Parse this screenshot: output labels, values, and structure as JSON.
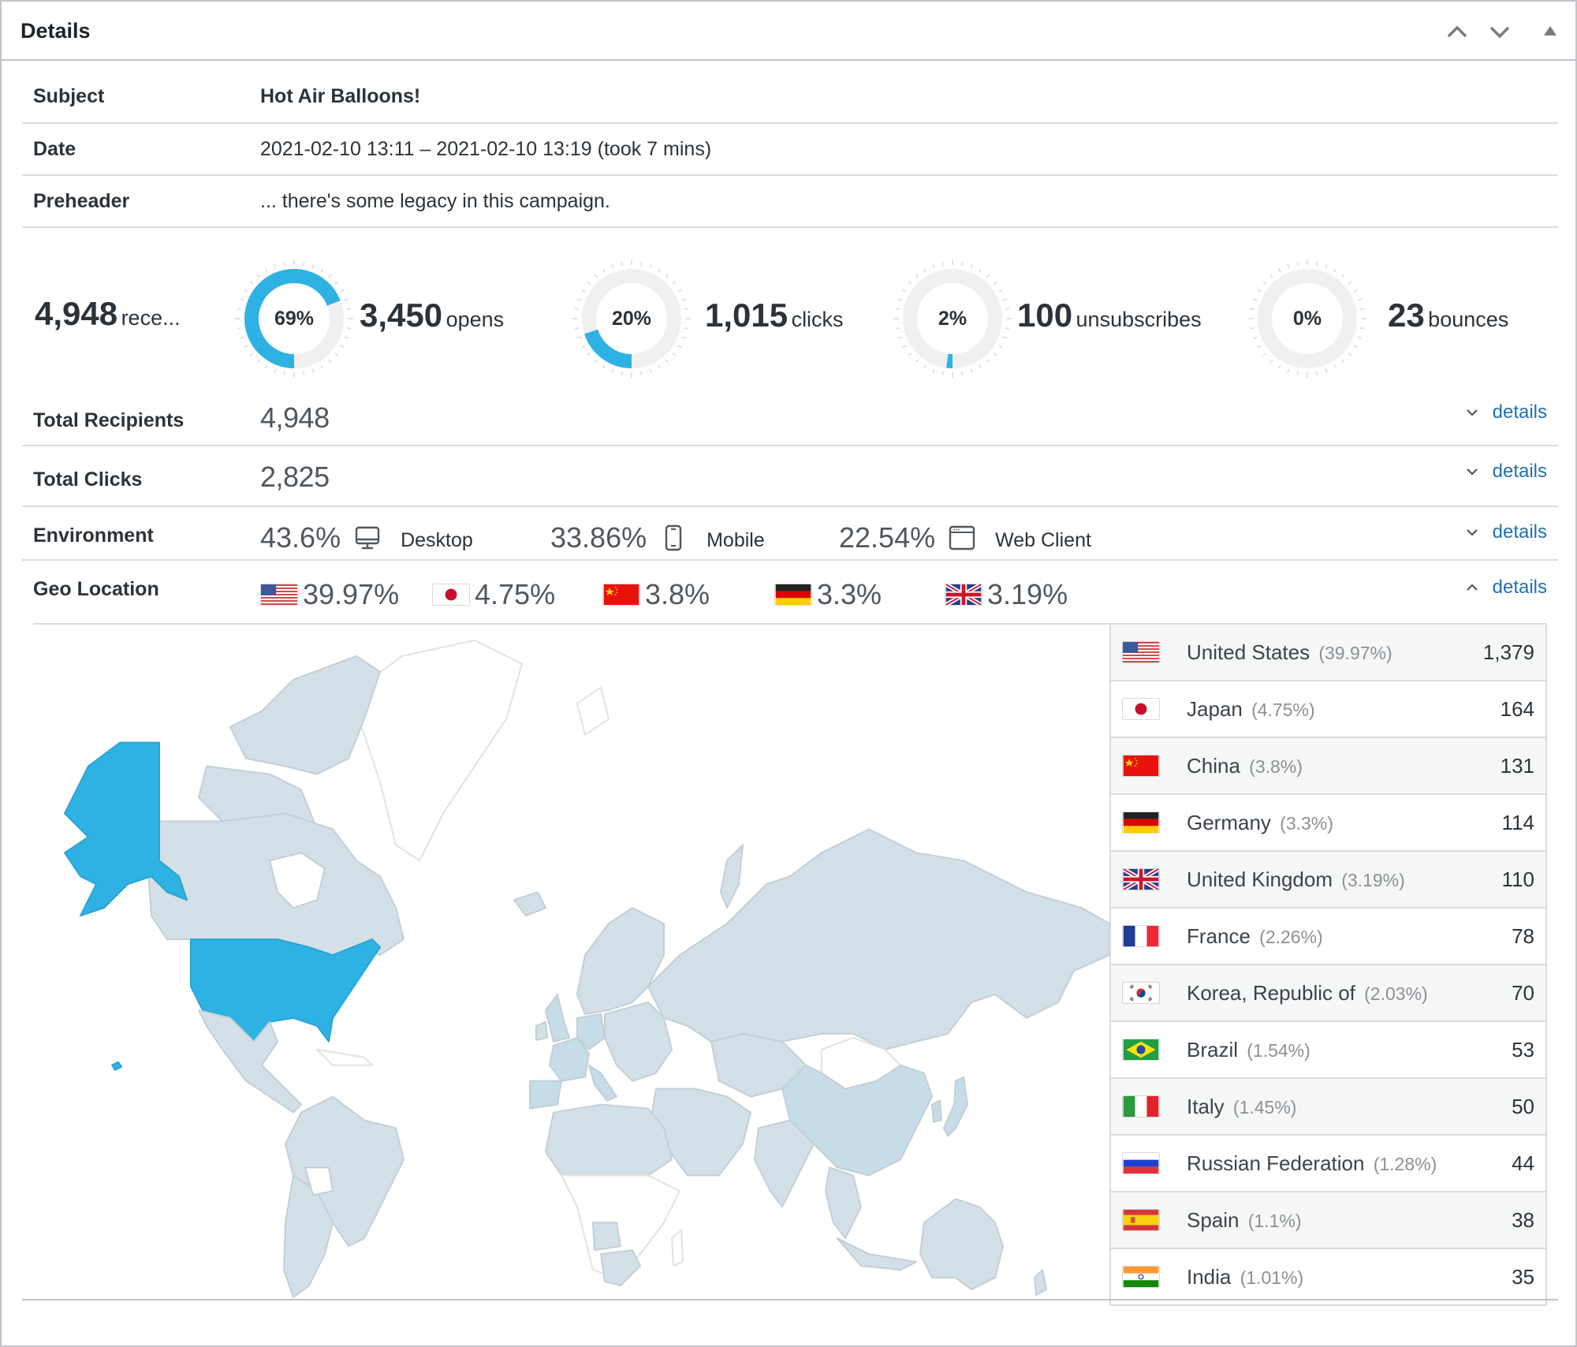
{
  "panel": {
    "title": "Details",
    "buttons": {
      "move_up": "Move up",
      "move_down": "Move down",
      "toggle": "Toggle panel"
    }
  },
  "info": {
    "subject_label": "Subject",
    "subject_value": "Hot Air Balloons!",
    "date_label": "Date",
    "date_value": "2021-02-10 13:11 – 2021-02-10 13:19 (took 7 mins)",
    "preheader_label": "Preheader",
    "preheader_value": "... there's some legacy in this campaign."
  },
  "stats": {
    "recipients": {
      "number": "4,948",
      "label": "rece..."
    },
    "opens": {
      "percent": 69,
      "percent_label": "69%",
      "number": "3,450",
      "label": "opens"
    },
    "clicks": {
      "percent": 20,
      "percent_label": "20%",
      "number": "1,015",
      "label": "clicks"
    },
    "unsubscribes": {
      "percent": 2,
      "percent_label": "2%",
      "number": "100",
      "label": "unsubscribes"
    },
    "bounces": {
      "percent": 0,
      "percent_label": "0%",
      "number": "23",
      "label": "bounces"
    }
  },
  "summary": {
    "total_recipients_label": "Total Recipients",
    "total_recipients_value": "4,948",
    "total_clicks_label": "Total Clicks",
    "total_clicks_value": "2,825",
    "environment_label": "Environment",
    "geo_label": "Geo Location",
    "details_link": "details"
  },
  "environment": [
    {
      "percent": "43.6%",
      "name": "Desktop",
      "icon": "desktop-icon"
    },
    {
      "percent": "33.86%",
      "name": "Mobile",
      "icon": "mobile-icon"
    },
    {
      "percent": "22.54%",
      "name": "Web Client",
      "icon": "browser-window-icon"
    }
  ],
  "geo_top": [
    {
      "code": "us",
      "percent": "39.97%"
    },
    {
      "code": "jp",
      "percent": "4.75%"
    },
    {
      "code": "cn",
      "percent": "3.8%"
    },
    {
      "code": "de",
      "percent": "3.3%"
    },
    {
      "code": "gb",
      "percent": "3.19%"
    }
  ],
  "countries": [
    {
      "code": "us",
      "name": "United States",
      "percent": "(39.97%)",
      "count": "1,379"
    },
    {
      "code": "jp",
      "name": "Japan",
      "percent": "(4.75%)",
      "count": "164"
    },
    {
      "code": "cn",
      "name": "China",
      "percent": "(3.8%)",
      "count": "131"
    },
    {
      "code": "de",
      "name": "Germany",
      "percent": "(3.3%)",
      "count": "114"
    },
    {
      "code": "gb",
      "name": "United Kingdom",
      "percent": "(3.19%)",
      "count": "110"
    },
    {
      "code": "fr",
      "name": "France",
      "percent": "(2.26%)",
      "count": "78"
    },
    {
      "code": "kr",
      "name": "Korea, Republic of",
      "percent": "(2.03%)",
      "count": "70"
    },
    {
      "code": "br",
      "name": "Brazil",
      "percent": "(1.54%)",
      "count": "53"
    },
    {
      "code": "it",
      "name": "Italy",
      "percent": "(1.45%)",
      "count": "50"
    },
    {
      "code": "ru",
      "name": "Russian Federation",
      "percent": "(1.28%)",
      "count": "44"
    },
    {
      "code": "es",
      "name": "Spain",
      "percent": "(1.1%)",
      "count": "38"
    },
    {
      "code": "in",
      "name": "India",
      "percent": "(1.01%)",
      "count": "35"
    }
  ],
  "colors": {
    "accent": "#2eb2e4",
    "ring_track": "#f0f0f0",
    "link": "#2271b1",
    "map_high": "#2eb2e4",
    "map_low": "#d4e0e7",
    "map_mid": "#c6dce7",
    "map_none": "#ffffff"
  }
}
